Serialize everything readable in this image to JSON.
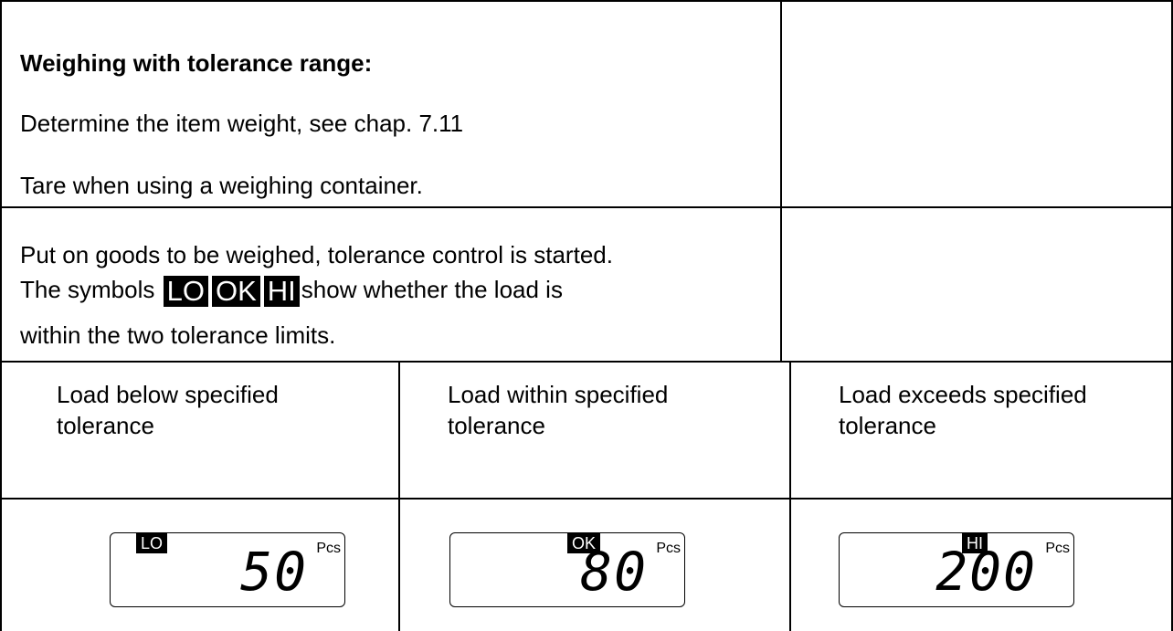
{
  "section_top": {
    "heading": "Weighing with tolerance range:",
    "line1": "Determine the item weight, see chap. 7.11",
    "line2": "Tare when using a weighing container."
  },
  "section_middle": {
    "line1": "Put on goods to be weighed, tolerance control is started.",
    "line2_before": "The symbols",
    "line2_after": "show whether the load is",
    "line3": "within the two tolerance limits.",
    "symbols": [
      "LO",
      "OK",
      "HI"
    ]
  },
  "cases": [
    {
      "label_line1": "Load below specified",
      "label_line2": "tolerance",
      "indicator": "LO",
      "value": "50",
      "unit": "Pcs"
    },
    {
      "label_line1": "Load within specified",
      "label_line2": "tolerance",
      "indicator": "OK",
      "value": "80",
      "unit": "Pcs"
    },
    {
      "label_line1": "Load exceeds specified",
      "label_line2": "tolerance",
      "indicator": "HI",
      "value": "200",
      "unit": "Pcs"
    }
  ]
}
